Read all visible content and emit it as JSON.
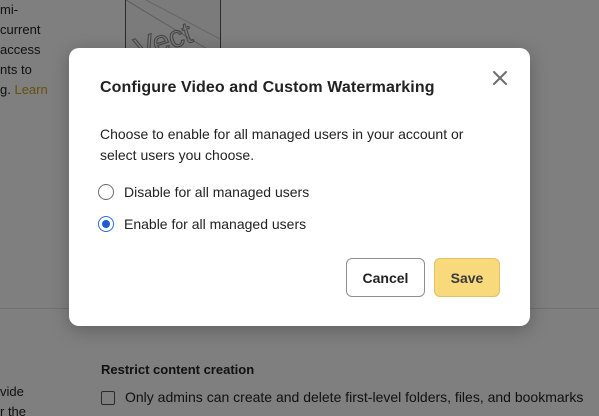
{
  "background": {
    "left_text_lines": [
      "mi-",
      "current",
      "access",
      "nts to"
    ],
    "left_text_last_prefix": "g. ",
    "left_text_learn": "Learn",
    "thumbnail_watermark": "Vect",
    "section_title": "Restrict content creation",
    "checkbox_label": "Only admins can create and delete first-level folders, files, and bookmarks",
    "bottom_left_lines": [
      "vide",
      "r the"
    ]
  },
  "dialog": {
    "title": "Configure Video and Custom Watermarking",
    "description": "Choose to enable for all managed users in your account or select users you choose.",
    "options": [
      {
        "label": "Disable for all managed users",
        "selected": false
      },
      {
        "label": "Enable for all managed users",
        "selected": true
      }
    ],
    "cancel_label": "Cancel",
    "save_label": "Save"
  },
  "colors": {
    "overlay": "rgba(0,0,0,0.5)",
    "accent_radio": "#1f5fd1",
    "save_button": "#f8d97c",
    "learn_link": "#c9a21a"
  },
  "icons": {
    "close": "close-icon"
  }
}
